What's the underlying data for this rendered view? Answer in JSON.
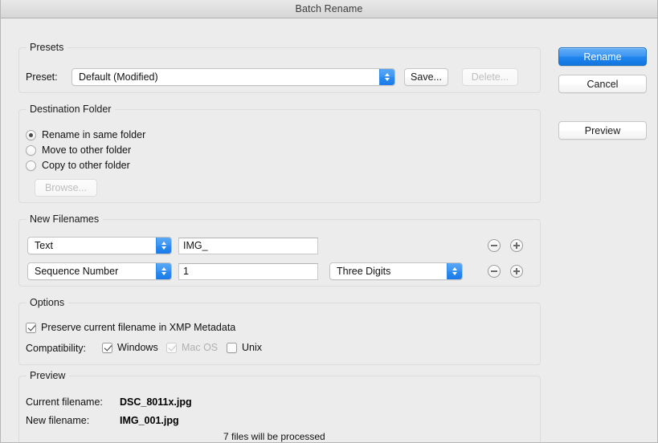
{
  "window": {
    "title": "Batch Rename"
  },
  "actions": {
    "rename": "Rename",
    "cancel": "Cancel",
    "preview": "Preview"
  },
  "presets": {
    "group_label": "Presets",
    "field_label": "Preset:",
    "selected": "Default (Modified)",
    "save_button": "Save...",
    "delete_button": "Delete..."
  },
  "destination": {
    "group_label": "Destination Folder",
    "options": [
      {
        "label": "Rename in same folder",
        "selected": true
      },
      {
        "label": "Move to other folder",
        "selected": false
      },
      {
        "label": "Copy to other folder",
        "selected": false
      }
    ],
    "browse_button": "Browse..."
  },
  "new_filenames": {
    "group_label": "New Filenames",
    "rows": [
      {
        "type": "Text",
        "value": "IMG_",
        "format": null,
        "minus": "minus-icon",
        "plus": "plus-icon"
      },
      {
        "type": "Sequence Number",
        "value": "1",
        "format": "Three Digits",
        "minus": "minus-icon",
        "plus": "plus-icon"
      }
    ]
  },
  "options": {
    "group_label": "Options",
    "preserve_filename": {
      "label": "Preserve current filename in XMP Metadata",
      "checked": true
    },
    "compatibility_label": "Compatibility:",
    "compatibility": [
      {
        "label": "Windows",
        "checked": true,
        "disabled": false
      },
      {
        "label": "Mac OS",
        "checked": true,
        "disabled": true
      },
      {
        "label": "Unix",
        "checked": false,
        "disabled": false
      }
    ]
  },
  "preview": {
    "group_label": "Preview",
    "current_label": "Current filename:",
    "current_value": "DSC_8011x.jpg",
    "new_label": "New filename:",
    "new_value": "IMG_001.jpg",
    "status": "7 files will be processed"
  },
  "colors": {
    "accent_blue": "#2186ee",
    "window_bg": "#ececec",
    "group_border": "#dcdcdc"
  }
}
